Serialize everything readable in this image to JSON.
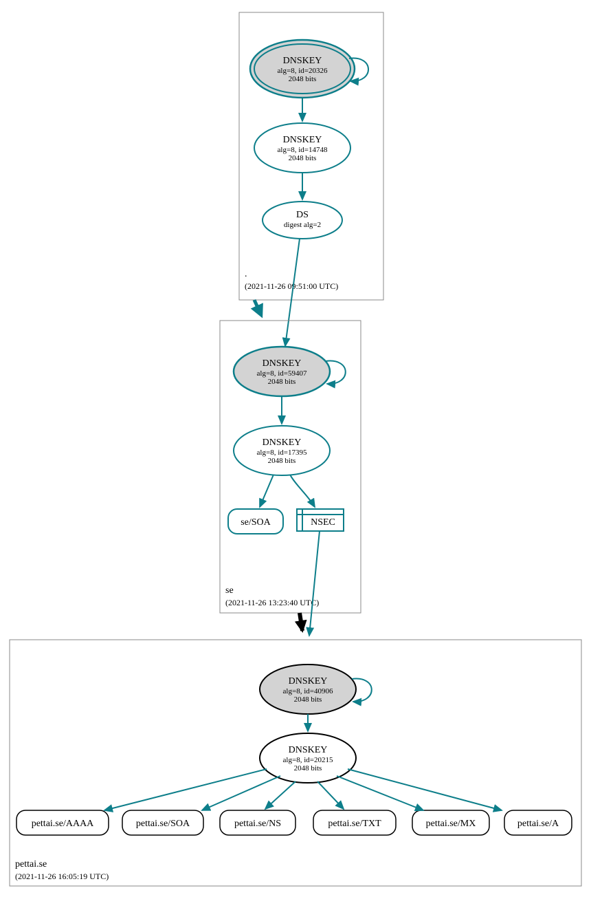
{
  "zones": {
    "root": {
      "name": ".",
      "timestamp": "(2021-11-26 09:51:00 UTC)",
      "ksk": {
        "title": "DNSKEY",
        "line1": "alg=8, id=20326",
        "line2": "2048 bits"
      },
      "zsk": {
        "title": "DNSKEY",
        "line1": "alg=8, id=14748",
        "line2": "2048 bits"
      },
      "ds": {
        "title": "DS",
        "line1": "digest alg=2"
      }
    },
    "se": {
      "name": "se",
      "timestamp": "(2021-11-26 13:23:40 UTC)",
      "ksk": {
        "title": "DNSKEY",
        "line1": "alg=8, id=59407",
        "line2": "2048 bits"
      },
      "zsk": {
        "title": "DNSKEY",
        "line1": "alg=8, id=17395",
        "line2": "2048 bits"
      },
      "soa": "se/SOA",
      "nsec": "NSEC"
    },
    "pettai": {
      "name": "pettai.se",
      "timestamp": "(2021-11-26 16:05:19 UTC)",
      "ksk": {
        "title": "DNSKEY",
        "line1": "alg=8, id=40906",
        "line2": "2048 bits"
      },
      "zsk": {
        "title": "DNSKEY",
        "line1": "alg=8, id=20215",
        "line2": "2048 bits"
      },
      "records": [
        "pettai.se/AAAA",
        "pettai.se/SOA",
        "pettai.se/NS",
        "pettai.se/TXT",
        "pettai.se/MX",
        "pettai.se/A"
      ]
    }
  },
  "colors": {
    "teal": "#0d7e8a",
    "grey": "#d3d3d3"
  }
}
